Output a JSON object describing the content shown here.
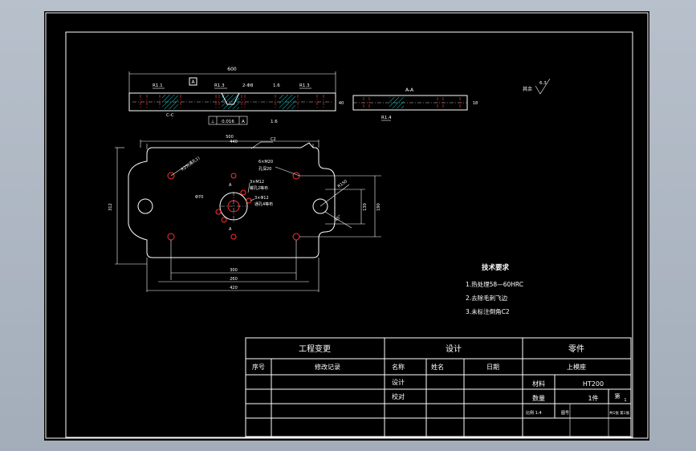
{
  "colors": {
    "background": "#000000",
    "lines": "#ffffff",
    "holes": "#ff3030",
    "sheet_outer": "#b0bac5"
  },
  "front_view": {
    "length_dim": "600",
    "datum": "A",
    "callouts": [
      "R1.1",
      "R1.3",
      "2-Φ8",
      "1.6",
      "R1.3"
    ],
    "section_mark": "C-C",
    "tolerance_frame": [
      "⊥",
      "0.016",
      "A"
    ],
    "roughness": "1.6"
  },
  "side_view": {
    "section": "A-A",
    "thickness_dim": "40",
    "height_dim": "18",
    "note": "R1.4"
  },
  "roughness_note": {
    "label": "其余",
    "value": "6.3"
  },
  "plan_view": {
    "dim_top_1": "500",
    "dim_top_2": "440",
    "chamfer": "C2",
    "dim_left": "312",
    "dim_bottom_1": "300",
    "dim_bottom_2": "260",
    "dim_bottom_3": "420",
    "dim_right": "190",
    "dim_right_2": "130",
    "radius": "R150",
    "hole_note_1": "6×M20",
    "hole_note_1b": "孔深20",
    "hole_note_2": "3×M12",
    "hole_note_2b": "螺孔2等布",
    "hole_note_3": "3×Φ12",
    "hole_note_3b": "通孔4等布",
    "center_hole": "Φ70",
    "left_note": "R25(通孔1)",
    "angle_note": "45°",
    "section_a": "A"
  },
  "tech_requirements": {
    "title": "技术要求",
    "items": [
      "1.热处理58—60HRC",
      "2.去除毛刺飞边",
      "3.未标注倒角C2"
    ]
  },
  "title_block": {
    "col1": "工程变更",
    "col2": "设计",
    "col3": "零件",
    "seq": "序号",
    "record": "修改记录",
    "name": "名称",
    "sign": "姓名",
    "date": "日期",
    "part_name": "上模座",
    "design": "设计",
    "check": "校对",
    "material_label": "材料",
    "material": "HT200",
    "qty_label": "数量",
    "qty": "1件",
    "page_label": "第",
    "page": "1",
    "scale": "比例 1:4",
    "sheet": "图号",
    "total": "共1张 第1张"
  }
}
